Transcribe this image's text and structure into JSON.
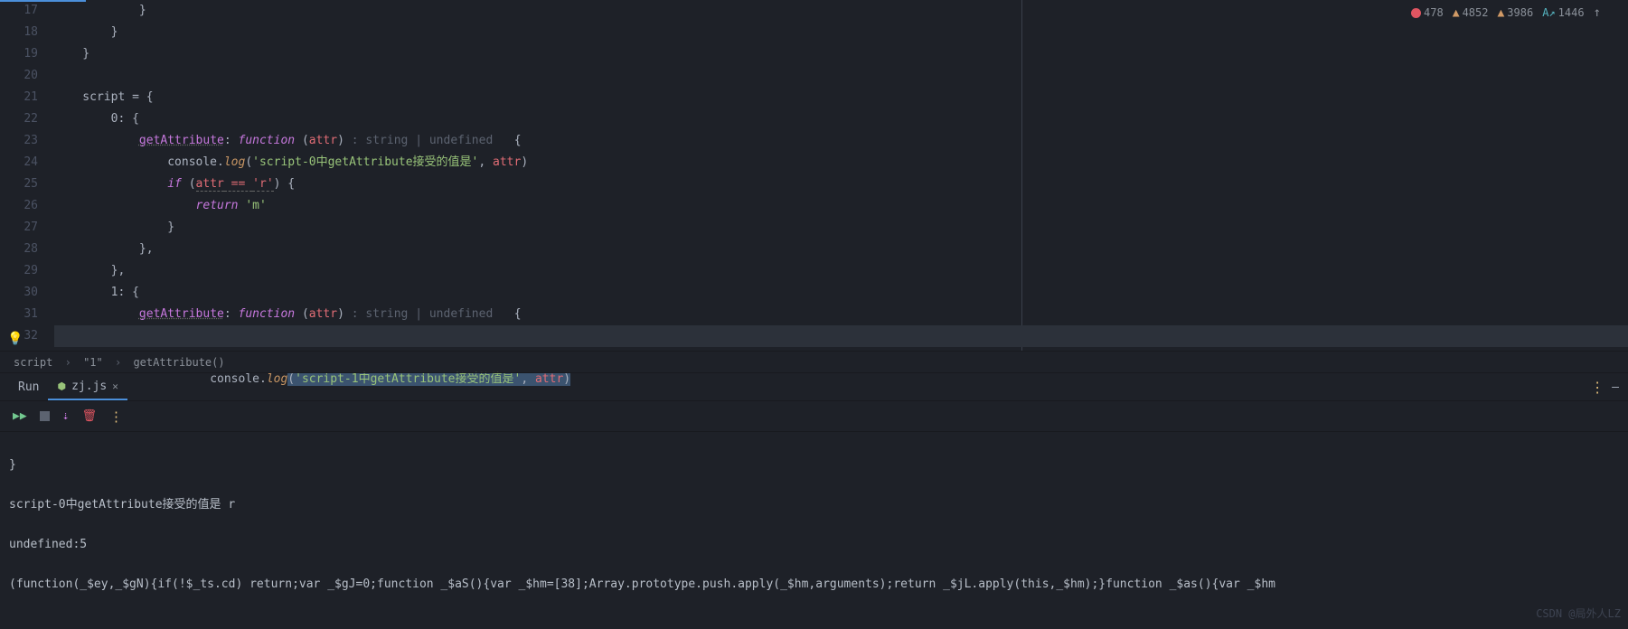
{
  "errors": {
    "error_count": "478",
    "warn1": "4852",
    "warn2": "3986",
    "info": "1446"
  },
  "gutter": [
    "17",
    "18",
    "19",
    "20",
    "21",
    "22",
    "23",
    "24",
    "25",
    "26",
    "27",
    "28",
    "29",
    "30",
    "31",
    "32"
  ],
  "code": {
    "l17": "            }",
    "l18": "        }",
    "l19": "    }",
    "l21_a": "    script ",
    "l21_b": "= {",
    "l22": "        0: {",
    "l23_a": "            ",
    "l23_prop": "getAttribute",
    "l23_b": ": ",
    "l23_fn": "function ",
    "l23_c": "(",
    "l23_p": "attr",
    "l23_d": ") ",
    "l23_hint": ": string | undefined ",
    "l23_e": "  {",
    "l24_a": "                console.",
    "l24_log": "log",
    "l24_b": "(",
    "l24_str": "'script-0中getAttribute接受的值是'",
    "l24_c": ", ",
    "l24_p": "attr",
    "l24_d": ")",
    "l25_a": "                ",
    "l25_if": "if ",
    "l25_b": "(",
    "l25_attr": "attr",
    "l25_eq": " == ",
    "l25_r": "'r'",
    "l25_c": ") {",
    "l26_a": "                    ",
    "l26_ret": "return ",
    "l26_m": "'m'",
    "l27": "                }",
    "l28": "            },",
    "l29": "        },",
    "l30": "        1: {",
    "l31_a": "            ",
    "l31_prop": "getAttribute",
    "l31_b": ": ",
    "l31_fn": "function ",
    "l31_c": "(",
    "l31_p": "attr",
    "l31_d": ") ",
    "l31_hint": ": string | undefined ",
    "l31_e": "  {",
    "l32_a": "                console.",
    "l32_log": "log",
    "l32_b": "(",
    "l32_str": "'script-1中getAttribute接受的值是'",
    "l32_c": ", ",
    "l32_p": "attr",
    "l32_d": ")"
  },
  "breadcrumb": {
    "a": "script",
    "b": "\"1\"",
    "c": "getAttribute()"
  },
  "tabs": {
    "run": "Run",
    "file": "zj.js"
  },
  "console": {
    "l1": "}",
    "l2": "script-0中getAttribute接受的值是 r",
    "l3": "undefined:5",
    "l4": "(function(_$ey,_$gN){if(!$_ts.cd) return;var _$gJ=0;function _$aS(){var _$hm=[38];Array.prototype.push.apply(_$hm,arguments);return _$jL.apply(this,_$hm);}function _$as(){var _$hm"
  },
  "watermark": "CSDN @局外人LZ"
}
